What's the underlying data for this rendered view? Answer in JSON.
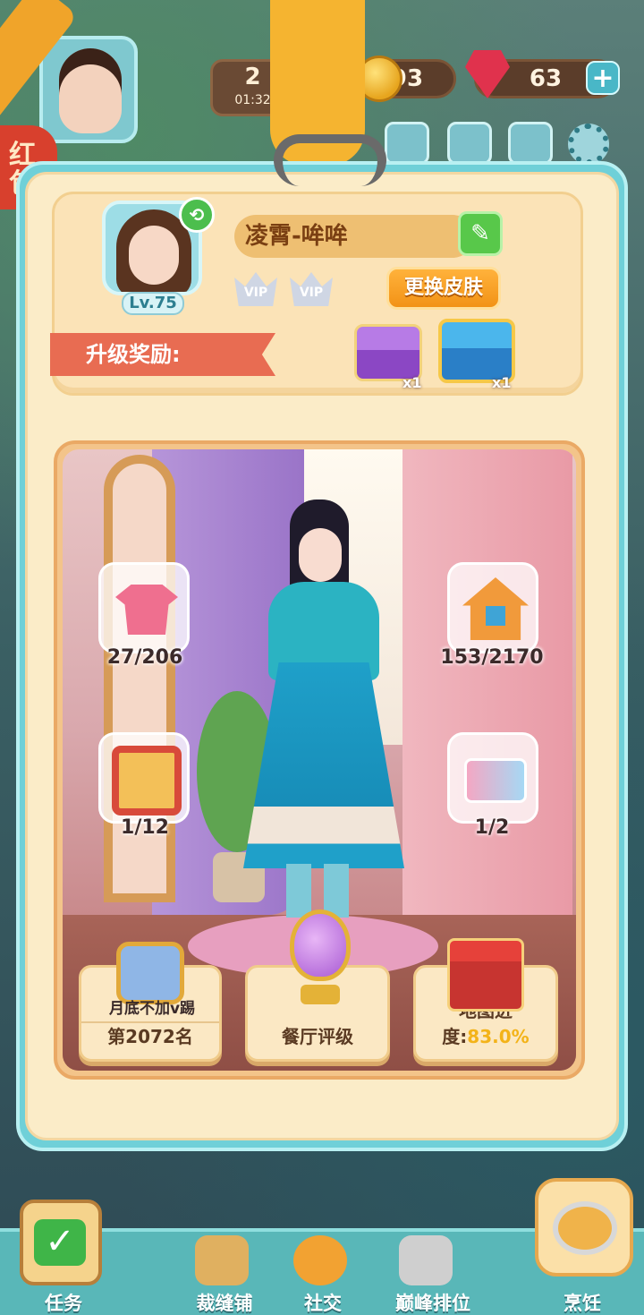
{
  "hud": {
    "lives_count": "2",
    "lives_timer": "01:32",
    "coins": "93",
    "gems": "63",
    "plus_label": "+",
    "red_packet_label": "红包"
  },
  "profile": {
    "player_name": "凌霄-哞哞",
    "level": "Lv.75",
    "vip_badges": [
      "VIP",
      "VIP"
    ],
    "change_skin_label": "更换皮肤",
    "upgrade_reward_label": "升级奖励:",
    "rewards": [
      {
        "icon": "purple-chest-icon",
        "count": "x1"
      },
      {
        "icon": "blue-chest-icon",
        "count": "x1"
      }
    ]
  },
  "stats": {
    "clothes": "27/206",
    "furniture": "153/2170",
    "photo_frames": "1/12",
    "id_cards": "1/2"
  },
  "cards": {
    "rank_sub": "月底不加v踢",
    "rank": "第2072名",
    "restaurant_rating": "餐厅评级",
    "map_progress_label": "地图进度:",
    "map_progress_value": "83.0%"
  },
  "nav": {
    "items": [
      "任务",
      "裁缝铺",
      "社交",
      "巅峰排位",
      "烹饪"
    ]
  },
  "colors": {
    "panel_border": "#6fd0d8",
    "panel_fill": "#fbecc8",
    "accent_orange": "#f29216",
    "ribbon_red": "#e86c52",
    "progress_yellow": "#f3b319"
  }
}
